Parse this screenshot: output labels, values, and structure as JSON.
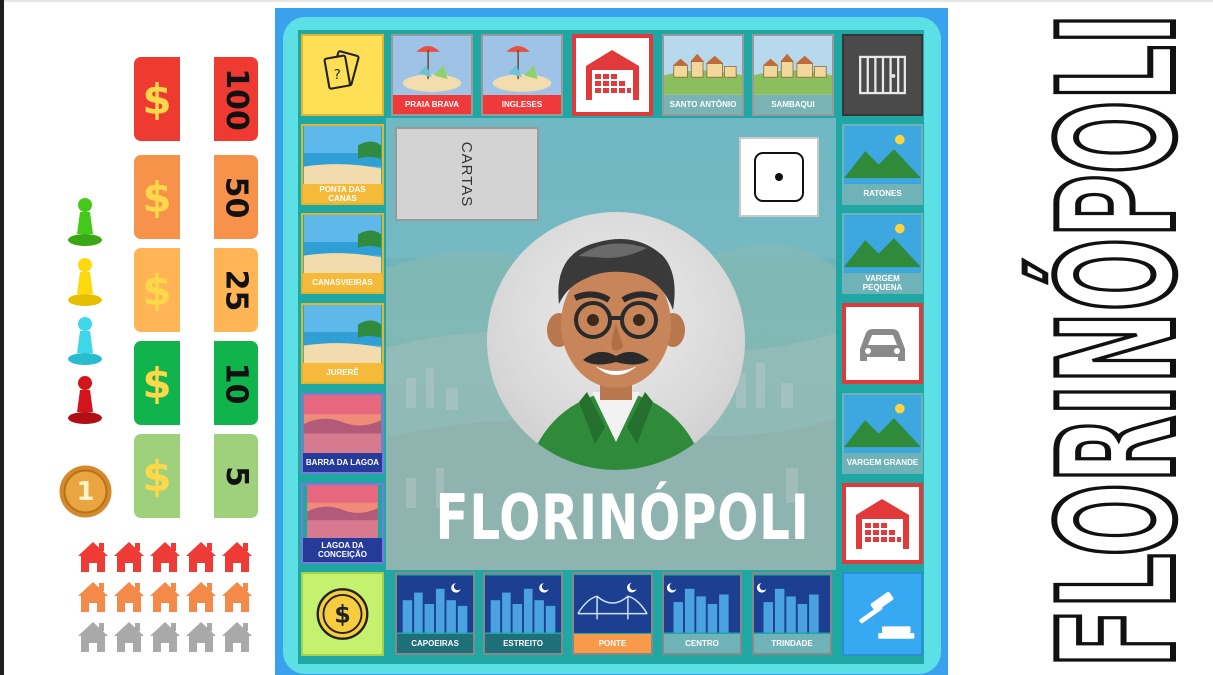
{
  "game_title": "FLORINÓPOLI",
  "side_title": "FLORINÓPOLI",
  "cartas_label": "CARTAS",
  "money": [
    {
      "value": "100",
      "symbol": "$",
      "color": "#ef3a32"
    },
    {
      "value": "50",
      "symbol": "$",
      "color": "#f7924a"
    },
    {
      "value": "25",
      "symbol": "$",
      "color": "#ffb555"
    },
    {
      "value": "10",
      "symbol": "$",
      "color": "#11b34d"
    },
    {
      "value": "5",
      "symbol": "$",
      "color": "#9fd17d"
    }
  ],
  "pawns": [
    {
      "color": "#44c81a"
    },
    {
      "color": "#ffd80e"
    },
    {
      "color": "#3fd6ea"
    },
    {
      "color": "#d3141b"
    }
  ],
  "coin_value": "1",
  "house_colors": [
    "#ee3b36",
    "#f48a4a",
    "#a9a9a9"
  ],
  "board": {
    "top": [
      {
        "label": "PRAIA BRAVA",
        "color": "#f0393a",
        "icon": "beach-chairs-icon"
      },
      {
        "label": "INGLESES",
        "color": "#f0393a",
        "icon": "beach-chairs-icon"
      },
      {
        "label": "SANTO ANTÔNIO",
        "color": "#7ab3b3",
        "icon": "village-icon"
      },
      {
        "label": "SAMBAQUI",
        "color": "#7ab3b3",
        "icon": "village-icon"
      }
    ],
    "left": [
      {
        "label": "PONTA DAS CANAS",
        "color": "#f5ba3a",
        "icon": "palm-beach-icon"
      },
      {
        "label": "CANASVIEIRAS",
        "color": "#f5ba3a",
        "icon": "palm-beach-icon"
      },
      {
        "label": "JURERÊ",
        "color": "#f5ba3a",
        "icon": "palm-beach-icon"
      },
      {
        "label": "BARRA DA LAGOA",
        "color": "#263a9a",
        "icon": "sunset-lake-icon"
      },
      {
        "label": "LAGOA DA CONCEIÇÃO",
        "color": "#263a9a",
        "icon": "sunset-lake-icon"
      }
    ],
    "right": [
      {
        "label": "RATONES",
        "color": "#6fb3b8",
        "icon": "mountain-sun-icon"
      },
      {
        "label": "VARGEM PEQUENA",
        "color": "#6fb3b8",
        "icon": "mountain-sun-icon"
      },
      {
        "label": "VARGEM GRANDE",
        "color": "#6fb3b8",
        "icon": "mountain-sun-icon"
      }
    ],
    "bottom": [
      {
        "label": "CAPOEIRAS",
        "color": "#1f6f78",
        "icon": "night-city-icon"
      },
      {
        "label": "ESTREITO",
        "color": "#1f6f78",
        "icon": "night-city-icon"
      },
      {
        "label": "PONTE",
        "color": "#f79a4a",
        "icon": "bridge-icon"
      },
      {
        "label": "CENTRO",
        "color": "#6fb3b8",
        "icon": "night-city-icon"
      },
      {
        "label": "TRINDADE",
        "color": "#6fb3b8",
        "icon": "night-city-icon"
      }
    ]
  },
  "die_value": 1
}
